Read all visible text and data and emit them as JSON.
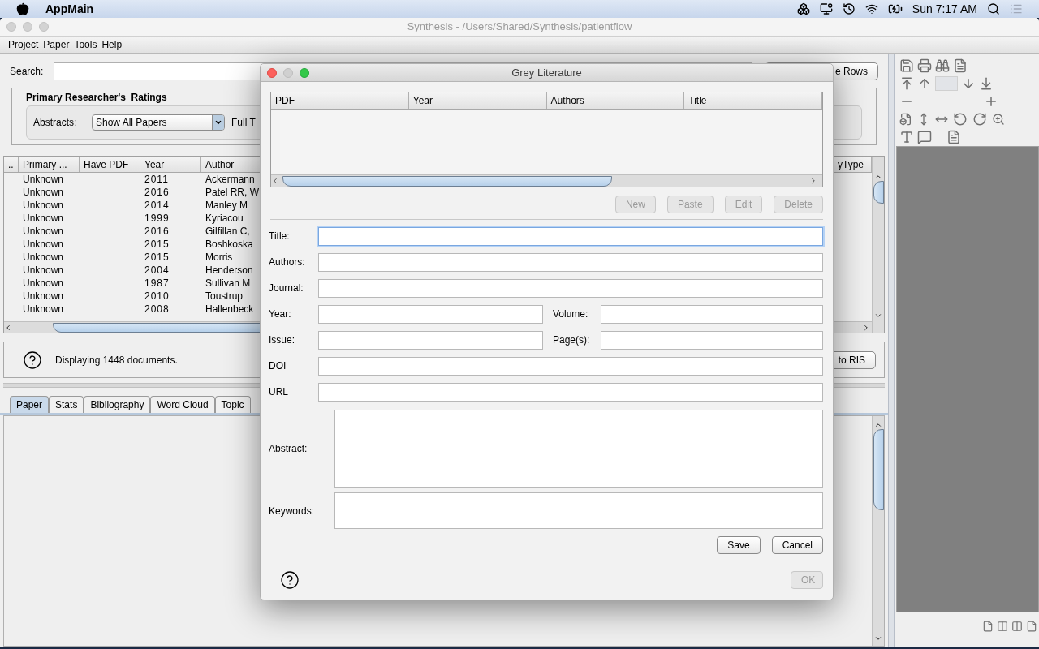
{
  "system_menu": {
    "app": "AppMain",
    "clock": "Sun 7:17 AM"
  },
  "window": {
    "title": "Synthesis - /Users/Shared/Synthesis/patientflow"
  },
  "menu": [
    "Project",
    "Paper",
    "Tools",
    "Help"
  ],
  "search": {
    "label": "Search:",
    "rows_button": "e Rows"
  },
  "ratings": {
    "title": "Primary Researcher's  Ratings",
    "abstracts_label": "Abstracts:",
    "abstracts_value": "Show All Papers",
    "fulltext_label": "Full T"
  },
  "table": {
    "columns": [
      "..",
      "Primary ...",
      "Have PDF",
      "Year",
      "Author"
    ],
    "column_right": "yType",
    "rows": [
      [
        "",
        "Unknown",
        "",
        "2011",
        "Ackermann"
      ],
      [
        "",
        "Unknown",
        "",
        "2016",
        "Patel RR, W"
      ],
      [
        "",
        "Unknown",
        "",
        "2014",
        "Manley M"
      ],
      [
        "",
        "Unknown",
        "",
        "1999",
        "Kyriacou"
      ],
      [
        "",
        "Unknown",
        "",
        "2016",
        "Gilfillan C,"
      ],
      [
        "",
        "Unknown",
        "",
        "2015",
        "Boshkoska"
      ],
      [
        "",
        "Unknown",
        "",
        "2015",
        "Morris"
      ],
      [
        "",
        "Unknown",
        "",
        "2004",
        "Henderson"
      ],
      [
        "",
        "Unknown",
        "",
        "1987",
        "Sullivan M"
      ],
      [
        "",
        "Unknown",
        "",
        "2010",
        "Toustrup"
      ],
      [
        "",
        "Unknown",
        "",
        "2008",
        "Hallenbeck"
      ]
    ]
  },
  "status": {
    "text": "Displaying 1448 documents.",
    "export_button": "to RIS"
  },
  "tabs": [
    {
      "label": "Paper",
      "selected": true
    },
    {
      "label": "Stats",
      "selected": false
    },
    {
      "label": "Bibliography",
      "selected": false
    },
    {
      "label": "Word Cloud",
      "selected": false
    },
    {
      "label": "Topic",
      "selected": false
    }
  ],
  "dialog": {
    "title": "Grey Literature",
    "columns": [
      "PDF",
      "Year",
      "Authors",
      "Title"
    ],
    "table_buttons": [
      {
        "label": "New",
        "disabled": true
      },
      {
        "label": "Paste",
        "disabled": true
      },
      {
        "label": "Edit",
        "disabled": true
      },
      {
        "label": "Delete",
        "disabled": true
      }
    ],
    "fields": [
      {
        "kind": "full",
        "label": "Title:",
        "focused": true
      },
      {
        "kind": "full",
        "label": "Authors:",
        "focused": false
      },
      {
        "kind": "full",
        "label": "Journal:",
        "focused": false
      },
      {
        "kind": "pair",
        "label": "Year:",
        "label2": "Volume:"
      },
      {
        "kind": "pair",
        "label": "Issue:",
        "label2": "Page(s):"
      },
      {
        "kind": "full",
        "label": "DOI",
        "focused": false
      },
      {
        "kind": "full",
        "label": "URL",
        "focused": false
      },
      {
        "kind": "area",
        "label": "Abstract:",
        "tall": true
      },
      {
        "kind": "area",
        "label": "Keywords:",
        "tall": false
      }
    ],
    "form_buttons": [
      {
        "label": "Save",
        "disabled": false
      },
      {
        "label": "Cancel",
        "disabled": false
      }
    ],
    "ok_button": {
      "label": "OK",
      "disabled": true
    }
  }
}
